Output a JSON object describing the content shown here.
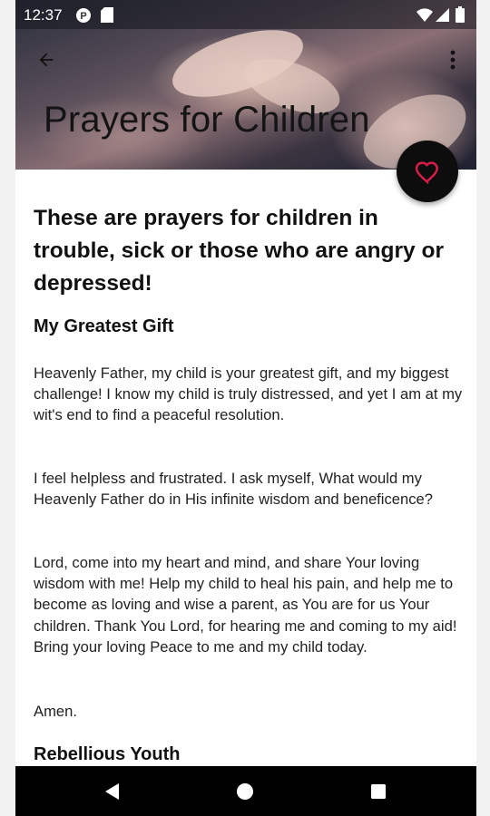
{
  "status_bar": {
    "time": "12:37"
  },
  "header": {
    "title": "Prayers for Children",
    "back_icon": "arrow-left-icon",
    "more_icon": "more-vert-icon"
  },
  "fab": {
    "icon": "heart-outline-icon",
    "color": "#d81b47"
  },
  "content": {
    "headline": "These are prayers for children in trouble, sick or those who are angry or depressed!",
    "sections": [
      {
        "title": "My Greatest Gift",
        "paragraphs": [
          "Heavenly Father, my child is your greatest gift, and my biggest challenge! I know my child is truly distressed, and yet I am at my wit's end to find a peaceful resolution.",
          "I feel helpless and frustrated. I ask myself, What would my Heavenly Father do in His infinite wisdom and beneficence?",
          "Lord, come into my heart and mind, and share Your loving wisdom with me! Help my child to heal his pain, and help me to become as loving and wise a parent, as You are for us Your children. Thank You Lord, for hearing me and coming to my aid! Bring your loving Peace to me and my child today.",
          "Amen."
        ]
      },
      {
        "title": "Rebellious Youth"
      }
    ]
  },
  "nav_bar": {
    "back": "nav-back-triangle-icon",
    "home": "nav-home-circle-icon",
    "recents": "nav-recents-square-icon"
  }
}
